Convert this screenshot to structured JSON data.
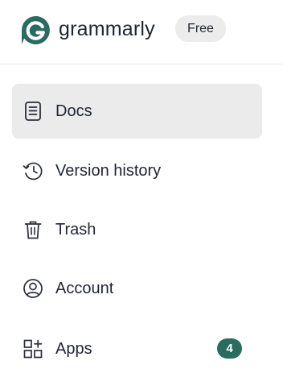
{
  "header": {
    "brand_name": "grammarly",
    "logo_icon": "grammarly-logo-icon",
    "plan_badge": "Free",
    "brand_color": "#15c39a",
    "logo_color": "#2c6b60"
  },
  "sidebar": {
    "items": [
      {
        "label": "Docs",
        "icon": "document-icon",
        "active": true
      },
      {
        "label": "Version history",
        "icon": "history-icon",
        "active": false
      },
      {
        "label": "Trash",
        "icon": "trash-icon",
        "active": false
      },
      {
        "label": "Account",
        "icon": "account-icon",
        "active": false
      },
      {
        "label": "Apps",
        "icon": "apps-grid-icon",
        "active": false,
        "badge": "4"
      }
    ],
    "badge_color": "#2c6b60",
    "active_background": "#ebebeb"
  }
}
